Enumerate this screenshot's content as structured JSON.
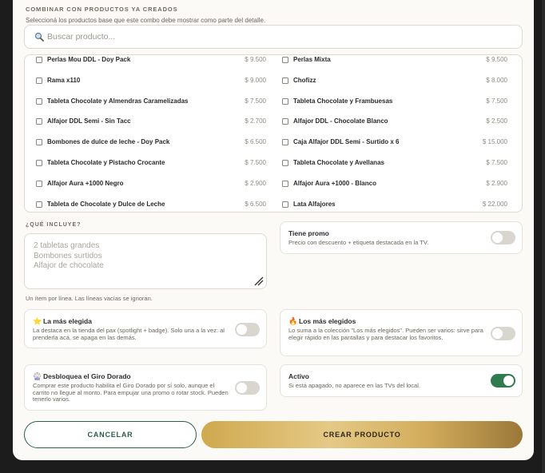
{
  "combinar": {
    "title": "COMBINAR CON PRODUCTOS YA CREADOS",
    "description": "Seleccioná los productos base que este combo debe mostrar como parte del detalle.",
    "search_placeholder": "Buscar producto...",
    "items": [
      {
        "name": "Perlas Mou DDL - Doy Pack",
        "price": "$ 9.500"
      },
      {
        "name": "Perlas Mixta",
        "price": "$ 9.500"
      },
      {
        "name": "Rama x110",
        "price": "$ 9.000"
      },
      {
        "name": "Chofizz",
        "price": "$ 8.000"
      },
      {
        "name": "Tableta Chocolate y Almendras Caramelizadas",
        "price": "$ 7.500"
      },
      {
        "name": "Tableta Chocolate y Frambuesas",
        "price": "$ 7.500"
      },
      {
        "name": "Alfajor DDL Semi - Sin Tacc",
        "price": "$ 2.700"
      },
      {
        "name": "Alfajor DDL - Chocolate Blanco",
        "price": "$ 2.500"
      },
      {
        "name": "Bombones de dulce de leche - Doy Pack",
        "price": "$ 6.500"
      },
      {
        "name": "Caja Alfajor DDL Semi - Surtido x 6",
        "price": "$ 15.000"
      },
      {
        "name": "Tableta Chocolate y Pistacho Crocante",
        "price": "$ 7.500"
      },
      {
        "name": "Tableta Chocolate y Avellanas",
        "price": "$ 7.500"
      },
      {
        "name": "Alfajor Aura +1000 Negro",
        "price": "$ 2.900"
      },
      {
        "name": "Alfajor Aura +1000 - Blanco",
        "price": "$ 2.900"
      },
      {
        "name": "Tableta de Chocolate y Dulce de Leche",
        "price": "$ 6.500"
      },
      {
        "name": "Lata Alfajores",
        "price": "$ 22.000"
      }
    ]
  },
  "incluye": {
    "label": "¿QUÉ INCLUYE?",
    "placeholder": "2 tabletas grandes\nBombones surtidos\nAlfajor de chocolate",
    "hint": "Un ítem por línea. Las líneas vacías se ignoran."
  },
  "options": {
    "promo": {
      "title": "Tiene promo",
      "desc": "Precio con descuento + etiqueta destacada en la TV.",
      "on": false
    },
    "mas_elegida": {
      "emoji": "⭐",
      "title": "La más elegida",
      "desc": "La destaca en la tienda del pax (spotlight + badge). Solo una a la vez: al prenderla acá, se apaga en las demás.",
      "on": false
    },
    "mas_elegidos": {
      "emoji": "🔥",
      "title": "Los más elegidos",
      "desc": "Lo suma a la colección \"Los más elegidos\". Pueden ser varios: sirve para elegir rápido en las pantallas y para destacar los favoritos.",
      "on": false
    },
    "giro": {
      "emoji": "🎡",
      "title": "Desbloquea el Giro Dorado",
      "desc": "Comprar este producto habilita el Giro Dorado por sí solo, aunque el carrito no llegue al monto. Para empujar una promo o rotar stock. Pueden tenerlo varios.",
      "on": false
    },
    "activo": {
      "title": "Activo",
      "desc": "Si está apagado, no aparece en las TVs del local.",
      "on": true
    }
  },
  "colors": {
    "accent_green": "#2f7a4f",
    "gold": "#cfa94e",
    "cancel_text": "#2b5b53"
  },
  "buttons": {
    "cancel": "CANCELAR",
    "create": "CREAR PRODUCTO"
  }
}
